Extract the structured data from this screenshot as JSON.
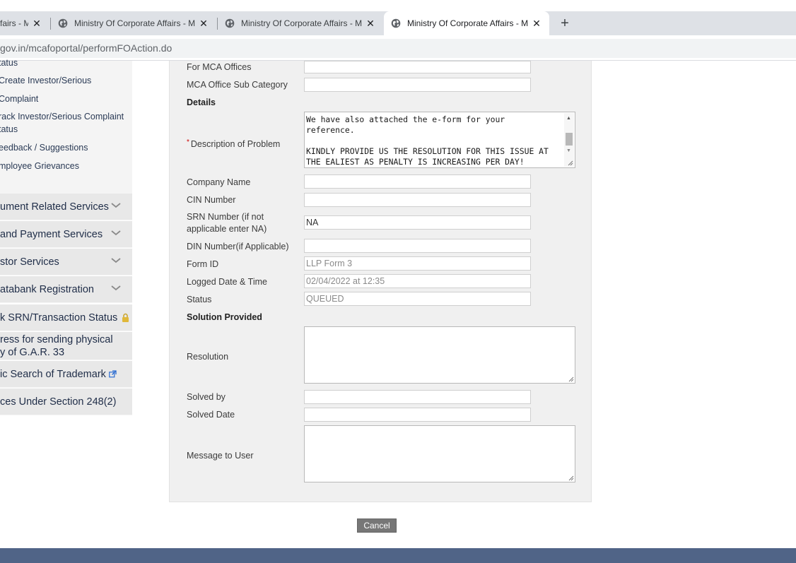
{
  "browser": {
    "tabs": [
      {
        "title": "fairs - M",
        "close": "✕"
      },
      {
        "title": "Ministry Of Corporate Affairs - M",
        "close": "✕"
      },
      {
        "title": "Ministry Of Corporate Affairs - M",
        "close": "✕"
      },
      {
        "title": "Ministry Of Corporate Affairs - M",
        "close": "✕"
      }
    ],
    "new_tab": "+",
    "url_host": "gov.in",
    "url_path": "/mcafoportal/performFOAction.do"
  },
  "sidebar": {
    "links": [
      "tatus",
      "Create Investor/Serious",
      "Complaint",
      "rack Investor/Serious Complaint",
      "tatus",
      "eedback / Suggestions",
      "mployee Grievances"
    ],
    "sections": [
      {
        "label": "ument Related Services"
      },
      {
        "label": "and Payment Services"
      },
      {
        "label": "stor Services"
      },
      {
        "label": "atabank Registration"
      },
      {
        "label": "k SRN/Transaction Status"
      },
      {
        "label_line1": "ress for sending physical",
        "label_line2": "y of G.A.R. 33"
      },
      {
        "label": "ic Search of Trademark"
      },
      {
        "label": "ces Under Section 248(2)"
      }
    ]
  },
  "form": {
    "for_mca_offices": {
      "label": "For MCA Offices",
      "value": ""
    },
    "mca_office_sub_category": {
      "label": "MCA Office Sub Category",
      "value": ""
    },
    "details_heading": "Details",
    "description": {
      "label": "Description of Problem",
      "required_mark": "*",
      "value": "We have also attached the e-form for your\nreference.\n\nKINDLY PROVIDE US THE RESOLUTION FOR THIS ISSUE AT\nTHE EALIEST AS PENALTY IS INCREASING PER DAY!"
    },
    "company_name": {
      "label": "Company Name",
      "value": ""
    },
    "cin_number": {
      "label": "CIN Number",
      "value": ""
    },
    "srn_number": {
      "label_line1": "SRN Number (if not",
      "label_line2": "applicable enter NA)",
      "value": "NA"
    },
    "din_number": {
      "label": "DIN Number(if Applicable)",
      "value": ""
    },
    "form_id": {
      "label": "Form ID",
      "value": "LLP Form 3"
    },
    "logged_date": {
      "label": "Logged Date & Time",
      "value": "02/04/2022 at 12:35"
    },
    "status": {
      "label": "Status",
      "value": "QUEUED"
    },
    "solution_heading": "Solution Provided",
    "resolution": {
      "label": "Resolution",
      "value": ""
    },
    "solved_by": {
      "label": "Solved by",
      "value": ""
    },
    "solved_date": {
      "label": "Solved Date",
      "value": ""
    },
    "message_to_user": {
      "label": "Message to User",
      "value": ""
    },
    "cancel_label": "Cancel"
  },
  "colors": {
    "footer": "#506487",
    "panel": "#f0f0f0",
    "sidebar_section": "#e8e8e8",
    "cancel_button": "#777777"
  }
}
